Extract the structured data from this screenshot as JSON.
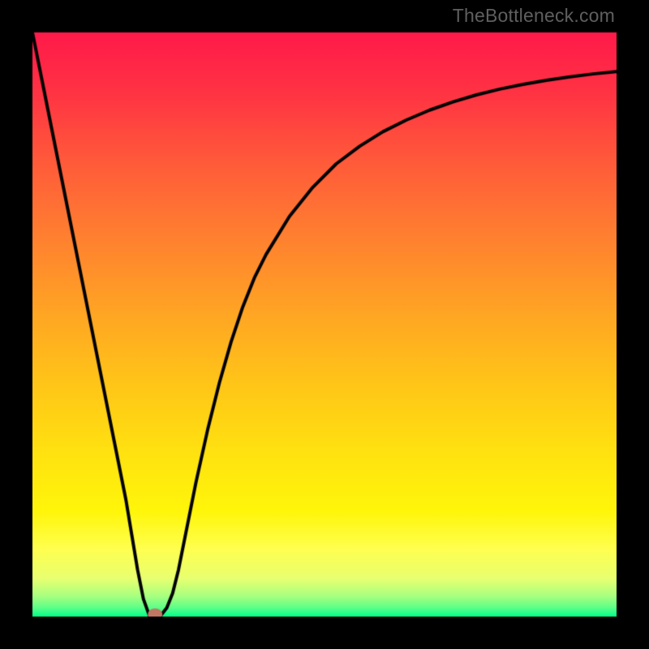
{
  "watermark": "TheBottleneck.com",
  "colors": {
    "frame": "#000000",
    "curve": "#000000",
    "marker": "#c27664",
    "gradient_stops": [
      {
        "pos": 0.0,
        "color": "#ff1a4a"
      },
      {
        "pos": 0.1,
        "color": "#ff3244"
      },
      {
        "pos": 0.22,
        "color": "#ff5a3a"
      },
      {
        "pos": 0.35,
        "color": "#ff8030"
      },
      {
        "pos": 0.48,
        "color": "#ffa524"
      },
      {
        "pos": 0.6,
        "color": "#ffc518"
      },
      {
        "pos": 0.72,
        "color": "#ffe210"
      },
      {
        "pos": 0.82,
        "color": "#fff60a"
      },
      {
        "pos": 0.885,
        "color": "#ffff50"
      },
      {
        "pos": 0.935,
        "color": "#e8ff70"
      },
      {
        "pos": 0.965,
        "color": "#a8ff80"
      },
      {
        "pos": 0.985,
        "color": "#5cff88"
      },
      {
        "pos": 1.0,
        "color": "#00ff8a"
      }
    ]
  },
  "chart_data": {
    "type": "line",
    "title": "",
    "xlabel": "",
    "ylabel": "",
    "xlim": [
      0,
      100
    ],
    "ylim": [
      0,
      100
    ],
    "series": [
      {
        "name": "curve",
        "x": [
          0,
          2,
          4,
          6,
          8,
          10,
          12,
          14,
          16,
          17,
          18,
          19,
          20,
          21,
          22,
          23,
          24,
          25,
          26,
          27,
          28,
          30,
          32,
          34,
          36,
          38,
          40,
          44,
          48,
          52,
          56,
          60,
          64,
          68,
          72,
          76,
          80,
          84,
          88,
          92,
          96,
          100
        ],
        "y": [
          100,
          90,
          80,
          70,
          60,
          50,
          40,
          30,
          20,
          14,
          8,
          3,
          0.2,
          0,
          0.2,
          1.5,
          4,
          8,
          13,
          18,
          23,
          32,
          40,
          47,
          53,
          58,
          62,
          68.5,
          73.5,
          77.5,
          80.5,
          83,
          85,
          86.7,
          88.1,
          89.3,
          90.3,
          91.1,
          91.8,
          92.4,
          92.9,
          93.3
        ]
      }
    ],
    "marker": {
      "x": 21,
      "y": 0
    },
    "grid": false,
    "legend": false
  }
}
